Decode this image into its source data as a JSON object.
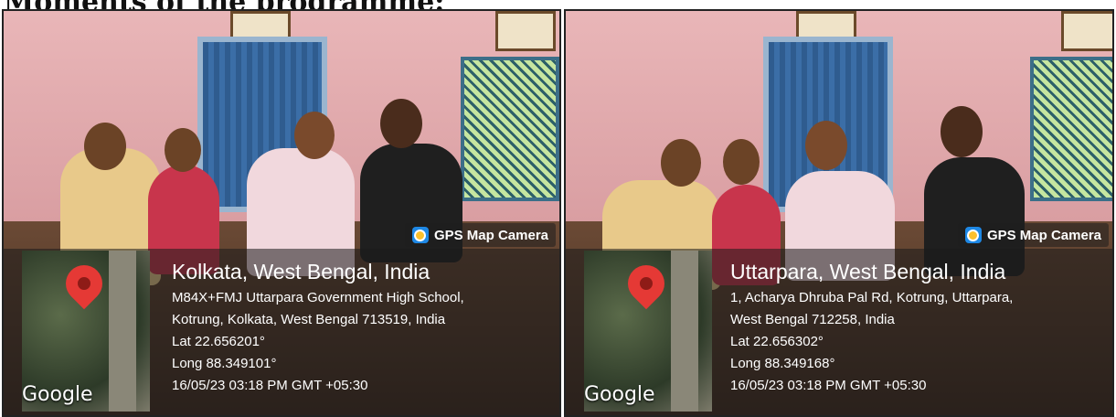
{
  "heading": "Moments of the programme:",
  "badge_label": "GPS Map Camera",
  "map_brand": "Google",
  "photos": [
    {
      "location": "Kolkata, West Bengal, India",
      "address_line1": "M84X+FMJ Uttarpara Government High School,",
      "address_line2": "Kotrung, Kolkata, West Bengal 713519, India",
      "lat": "Lat 22.656201°",
      "long": "Long 88.349101°",
      "timestamp": "16/05/23 03:18 PM GMT +05:30"
    },
    {
      "location": "Uttarpara, West Bengal, India",
      "address_line1": "1, Acharya Dhruba Pal Rd, Kotrung, Uttarpara,",
      "address_line2": "West Bengal 712258, India",
      "lat": "Lat 22.656302°",
      "long": "Long 88.349168°",
      "timestamp": "16/05/23 03:18 PM GMT +05:30"
    }
  ],
  "colors": {
    "pin": "#e53935",
    "badge_logo": "#1e88e5"
  }
}
